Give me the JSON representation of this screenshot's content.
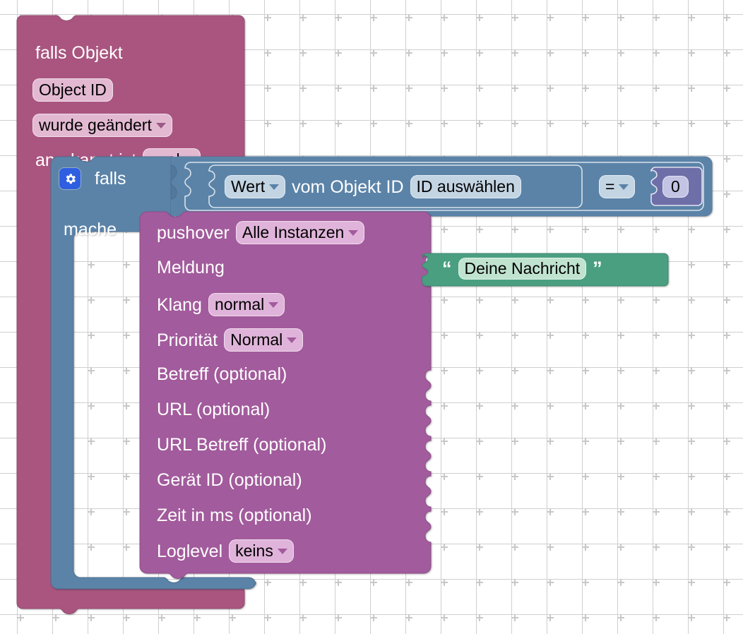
{
  "workspace": {
    "background_color": "#ffffff",
    "grid_color": "#c8c8c8",
    "grid_spacing": 50
  },
  "colors": {
    "trigger_rose": "#a9557f",
    "control_blue": "#5b83a8",
    "pushover_plum": "#a25b9c",
    "text_green": "#4a9f81",
    "math_indigo": "#6e6fa8",
    "field_rose": "#e3b9d2",
    "field_plum": "#e0b4da",
    "field_blue": "#c3d4e3",
    "field_green": "#bfe3cf",
    "field_indigo": "#c3c3e4",
    "gear_blue": "#2f5fe0"
  },
  "blocks": {
    "trigger": {
      "name": "falls Objekt",
      "title": "falls Objekt",
      "object_id_field": "Object ID",
      "change_type_field": "wurde geändert",
      "ack_label": "anerkannt ist",
      "ack_field": "egal"
    },
    "controls_if": {
      "gear_icon": "gear-icon",
      "if_label": "falls",
      "do_label": "mache"
    },
    "condition": {
      "value_field": "Wert",
      "mid_label": "vom Objekt ID",
      "object_id_field": "ID auswählen",
      "operator_field": "=",
      "number_value": "0"
    },
    "pushover": {
      "title": "pushover",
      "instance_field": "Alle Instanzen",
      "rows": [
        {
          "label": "Meldung",
          "kind": "value-input",
          "connected": "text-block"
        },
        {
          "label": "Klang",
          "kind": "dropdown",
          "value": "normal"
        },
        {
          "label": "Priorität",
          "kind": "dropdown",
          "value": "Normal"
        },
        {
          "label": "Betreff (optional)",
          "kind": "value-input",
          "connected": null
        },
        {
          "label": "URL (optional)",
          "kind": "value-input",
          "connected": null
        },
        {
          "label": "URL Betreff (optional)",
          "kind": "value-input",
          "connected": null
        },
        {
          "label": "Gerät ID (optional)",
          "kind": "value-input",
          "connected": null
        },
        {
          "label": "Zeit in ms (optional)",
          "kind": "value-input",
          "connected": null
        },
        {
          "label": "Loglevel",
          "kind": "dropdown",
          "value": "keins"
        }
      ]
    },
    "text_block": {
      "open_quote": "“",
      "close_quote": "”",
      "text_value": "Deine Nachricht"
    }
  }
}
